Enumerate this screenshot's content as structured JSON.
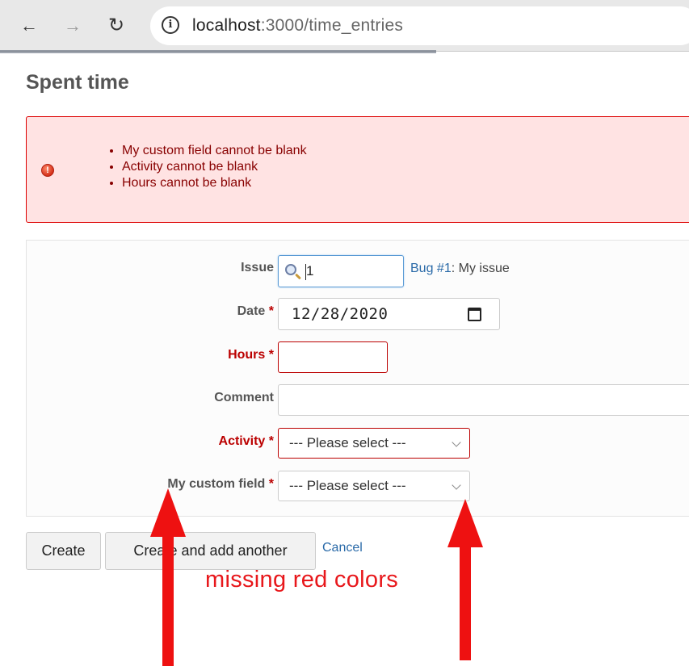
{
  "browser": {
    "url_host": "localhost",
    "url_path": ":3000/time_entries",
    "info_icon": "ⓘ"
  },
  "page": {
    "title": "Spent time"
  },
  "errors": [
    "My custom field cannot be blank",
    "Activity cannot be blank",
    "Hours cannot be blank"
  ],
  "form": {
    "issue": {
      "label": "Issue",
      "value": "1",
      "link_text": "Bug #1",
      "subject": ": My issue"
    },
    "date": {
      "label": "Date",
      "required_mark": "*",
      "value": "12/28/2020"
    },
    "hours": {
      "label": "Hours",
      "required_mark": "*",
      "value": ""
    },
    "comment": {
      "label": "Comment",
      "value": ""
    },
    "activity": {
      "label": "Activity",
      "required_mark": "*",
      "selected": "--- Please select ---"
    },
    "custom_field": {
      "label": "My custom field",
      "required_mark": "*",
      "selected": "--- Please select ---"
    }
  },
  "actions": {
    "create": "Create",
    "create_another": "Create and add another",
    "cancel": "Cancel"
  },
  "annotation": {
    "text": "missing red colors",
    "color": "#e8171b"
  },
  "colors": {
    "error_text": "#880000",
    "error_bg": "#ffe3e3",
    "required_red": "#bb0000",
    "link_blue": "#2a6aa8"
  }
}
